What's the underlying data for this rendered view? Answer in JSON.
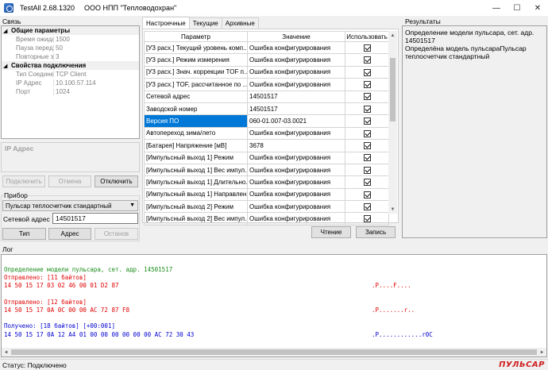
{
  "window": {
    "app_version": "TestAll 2.68.1320",
    "organization": "ООО НПП \"Тепловодохран\"",
    "minimize_icon": "minimize-icon",
    "maximize_icon": "maximize-icon",
    "close_icon": "close-icon"
  },
  "connection": {
    "label": "Связь",
    "grid": {
      "cat_general": "Общие параметры",
      "wait_time_label": "Время ожидания",
      "wait_time_value": "1500",
      "pause_label": "Пауза перед запр",
      "pause_value": "50",
      "retries_label": "Повторные запро",
      "retries_value": "3",
      "cat_conn": "Свойства подключения",
      "conn_type_label": "Тип Соединения",
      "conn_type_value": "TCP Client",
      "ip_label": "IP Адрес",
      "ip_value": "10.100.57.114",
      "port_label": "Порт",
      "port_value": "1024"
    },
    "description_title": "IP Адрес",
    "btn_connect": "Подключить",
    "btn_cancel": "Отмена",
    "btn_disconnect": "Отключить"
  },
  "device": {
    "label": "Прибор",
    "selected_device": "Пульсар теплосчетчик стандартный",
    "address_label": "Сетевой адрес",
    "address_value": "14501517",
    "btn_type": "Тип",
    "btn_address": "Адрес",
    "btn_stop": "Останов"
  },
  "tabs": [
    "Настроечные",
    "Текущие",
    "Архивные"
  ],
  "settings_grid": {
    "col_param": "Параметр",
    "col_value": "Значение",
    "col_use": "Использовать",
    "rows": [
      {
        "param": "[УЗ расх.] Текущий уровень комп...",
        "value": "Ошибка конфигурирования",
        "use": true
      },
      {
        "param": "[УЗ расх.] Режим измерения",
        "value": "Ошибка конфигурирования",
        "use": true
      },
      {
        "param": "[УЗ расх.] Знач. коррекции TOF п...",
        "value": "Ошибка конфигурирования",
        "use": true
      },
      {
        "param": "[УЗ расх.] TOF, рассчитанное по ...",
        "value": "Ошибка конфигурирования",
        "use": true
      },
      {
        "param": "Сетевой адрес",
        "value": "14501517",
        "use": true
      },
      {
        "param": "Заводской номер",
        "value": "14501517",
        "use": true
      },
      {
        "param": "Версия ПО",
        "value": "060-01.007-03.0021",
        "use": true
      },
      {
        "param": "Автопереход зима/лето",
        "value": "Ошибка конфигурирования",
        "use": true
      },
      {
        "param": "[Батарея] Напряжение [мВ]",
        "value": "3678",
        "use": true
      },
      {
        "param": "[Импульсный выход 1] Режим",
        "value": "Ошибка конфигурирования",
        "use": true
      },
      {
        "param": "[Импульсный выход 1] Вес импул...",
        "value": "Ошибка конфигурирования",
        "use": true
      },
      {
        "param": "[Импульсный выход 1] Длительно...",
        "value": "Ошибка конфигурирования",
        "use": true
      },
      {
        "param": "[Импульсный выход 1] Направлен...",
        "value": "Ошибка конфигурирования",
        "use": true
      },
      {
        "param": "[Импульсный выход 2] Режим",
        "value": "Ошибка конфигурирования",
        "use": true
      },
      {
        "param": "[Импульсный выход 2] Вес импул...",
        "value": "Ошибка конфигурирования",
        "use": true
      }
    ],
    "selected_row": 6,
    "btn_read": "Чтение",
    "btn_write": "Запись"
  },
  "results": {
    "label": "Результаты",
    "line1": "Определение модели пульсара, сет. адр. 14501517",
    "line2": "Определёна модель пульсараПульсар теплосчетчик стандартный"
  },
  "log": {
    "label": "Лог",
    "lines": [
      {
        "text": "Определение модели пульсара, сет. адр. 14501517",
        "ascii": "",
        "color": "#1a8c1a"
      },
      {
        "text": "Отправлено: [11 байтов]",
        "ascii": "",
        "color": "#e00000"
      },
      {
        "text": "14 50 15 17 03 02 46 00 01 D2 87",
        "ascii": ".P....F....",
        "color": "#e00000"
      },
      {
        "text": "",
        "ascii": "",
        "color": "#000000"
      },
      {
        "text": "Отправлено: [12 байтов]",
        "ascii": "",
        "color": "#e00000"
      },
      {
        "text": "14 50 15 17 0A 0C 00 00 AC 72 87 F8",
        "ascii": ".P.......r..",
        "color": "#e00000"
      },
      {
        "text": "",
        "ascii": "",
        "color": "#000000"
      },
      {
        "text": "Получено: [18 байтов] [+00:001]",
        "ascii": "",
        "color": "#0000d0"
      },
      {
        "text": "14 50 15 17 0A 12 A4 01 00 00 00 00 00 00 AC 72 30 43",
        "ascii": ".P............r0C",
        "color": "#0000d0"
      }
    ]
  },
  "status": {
    "text": "Статус: Подключено",
    "logo_text": "ПУЛЬСАР"
  }
}
